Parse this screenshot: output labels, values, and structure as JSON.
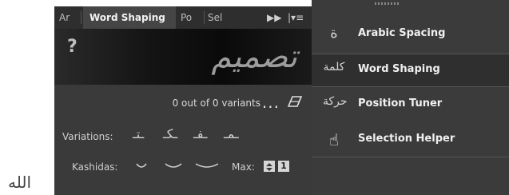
{
  "tabs": {
    "arabic": "Ar",
    "word_shaping": "Word Shaping",
    "position": "Po",
    "selection": "Sel",
    "overflow_icon": "fast-forward-icon",
    "menu_icon": "panel-menu-icon"
  },
  "preview": {
    "help": "?",
    "sample": "تصميم"
  },
  "variants": {
    "count_text": "0 out of 0 variants",
    "more": "...",
    "clear_icon": "eraser-icon"
  },
  "variations": {
    "label": "Variations:",
    "glyphs": [
      "ـتـ",
      "ـكـ",
      "ـفـ",
      "ـمـ"
    ]
  },
  "kashidas": {
    "label": "Kashidas:",
    "max_label": "Max:",
    "max_value": "1"
  },
  "menu": {
    "items": [
      {
        "label": "Arabic Spacing",
        "icon": "ة"
      },
      {
        "label": "Word Shaping",
        "icon": "كلمة"
      },
      {
        "label": "Position Tuner",
        "icon": "حركة"
      },
      {
        "label": "Selection Helper",
        "icon": "☝"
      }
    ]
  },
  "outside_text": "الله"
}
